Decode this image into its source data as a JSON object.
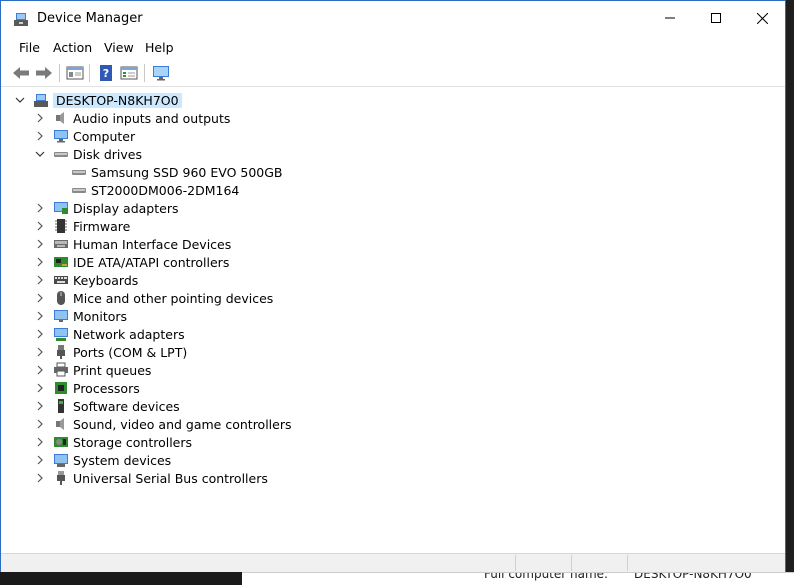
{
  "window": {
    "title": "Device Manager"
  },
  "menu": [
    "File",
    "Action",
    "View",
    "Help"
  ],
  "tree": {
    "root": "DESKTOP-N8KH7O0",
    "nodes": [
      {
        "label": "Audio inputs and outputs",
        "icon": "speaker-icon",
        "expanded": false
      },
      {
        "label": "Computer",
        "icon": "computer-icon",
        "expanded": false
      },
      {
        "label": "Disk drives",
        "icon": "disk-drive-icon",
        "expanded": true,
        "children": [
          "Samsung SSD 960 EVO 500GB",
          "ST2000DM006-2DM164"
        ]
      },
      {
        "label": "Display adapters",
        "icon": "display-adapter-icon",
        "expanded": false
      },
      {
        "label": "Firmware",
        "icon": "firmware-icon",
        "expanded": false
      },
      {
        "label": "Human Interface Devices",
        "icon": "hid-icon",
        "expanded": false
      },
      {
        "label": "IDE ATA/ATAPI controllers",
        "icon": "ide-controller-icon",
        "expanded": false
      },
      {
        "label": "Keyboards",
        "icon": "keyboard-icon",
        "expanded": false
      },
      {
        "label": "Mice and other pointing devices",
        "icon": "mouse-icon",
        "expanded": false
      },
      {
        "label": "Monitors",
        "icon": "monitor-icon",
        "expanded": false
      },
      {
        "label": "Network adapters",
        "icon": "network-adapter-icon",
        "expanded": false
      },
      {
        "label": "Ports (COM & LPT)",
        "icon": "port-icon",
        "expanded": false
      },
      {
        "label": "Print queues",
        "icon": "printer-icon",
        "expanded": false
      },
      {
        "label": "Processors",
        "icon": "processor-icon",
        "expanded": false
      },
      {
        "label": "Software devices",
        "icon": "software-device-icon",
        "expanded": false
      },
      {
        "label": "Sound, video and game controllers",
        "icon": "sound-controller-icon",
        "expanded": false
      },
      {
        "label": "Storage controllers",
        "icon": "storage-controller-icon",
        "expanded": false
      },
      {
        "label": "System devices",
        "icon": "system-device-icon",
        "expanded": false
      },
      {
        "label": "Universal Serial Bus controllers",
        "icon": "usb-icon",
        "expanded": false
      }
    ]
  },
  "background": {
    "fragment_left": "Full computer name:",
    "fragment_right": "DESKTOP-N8KH7O0"
  },
  "colors": {
    "selection": "#cce8ff",
    "window_border": "#2b6cc4"
  }
}
